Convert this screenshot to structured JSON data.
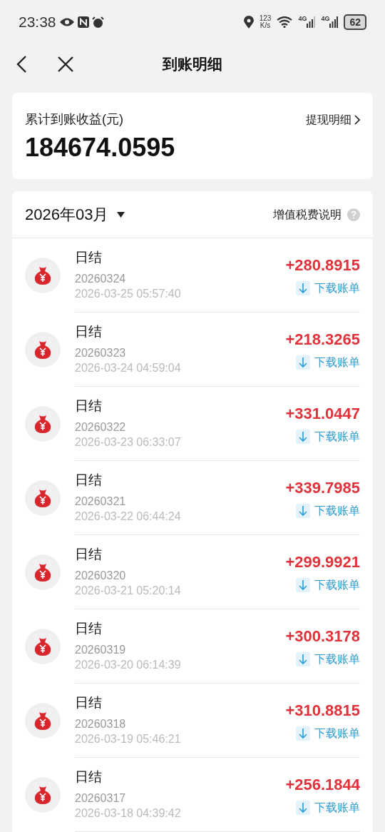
{
  "status_bar": {
    "time": "23:38",
    "speed_value": "123",
    "speed_unit": "K/s",
    "network_1": "4G",
    "network_2": "4G",
    "battery": "62"
  },
  "header": {
    "title": "到账明细"
  },
  "summary": {
    "label": "累计到账收益(元)",
    "link": "提现明细",
    "amount": "184674.0595"
  },
  "list": {
    "month": "2026年03月",
    "tax_link": "增值税费说明",
    "rows": [
      {
        "title": "日结",
        "code": "20260324",
        "time": "2026-03-25 05:57:40",
        "amount": "+280.8915",
        "action": "下载账单"
      },
      {
        "title": "日结",
        "code": "20260323",
        "time": "2026-03-24 04:59:04",
        "amount": "+218.3265",
        "action": "下载账单"
      },
      {
        "title": "日结",
        "code": "20260322",
        "time": "2026-03-23 06:33:07",
        "amount": "+331.0447",
        "action": "下载账单"
      },
      {
        "title": "日结",
        "code": "20260321",
        "time": "2026-03-22 06:44:24",
        "amount": "+339.7985",
        "action": "下载账单"
      },
      {
        "title": "日结",
        "code": "20260320",
        "time": "2026-03-21 05:20:14",
        "amount": "+299.9921",
        "action": "下载账单"
      },
      {
        "title": "日结",
        "code": "20260319",
        "time": "2026-03-20 06:14:39",
        "amount": "+300.3178",
        "action": "下载账单"
      },
      {
        "title": "日结",
        "code": "20260318",
        "time": "2026-03-19 05:46:21",
        "amount": "+310.8815",
        "action": "下载账单"
      },
      {
        "title": "日结",
        "code": "20260317",
        "time": "2026-03-18 04:39:42",
        "amount": "+256.1844",
        "action": "下载账单"
      }
    ]
  }
}
